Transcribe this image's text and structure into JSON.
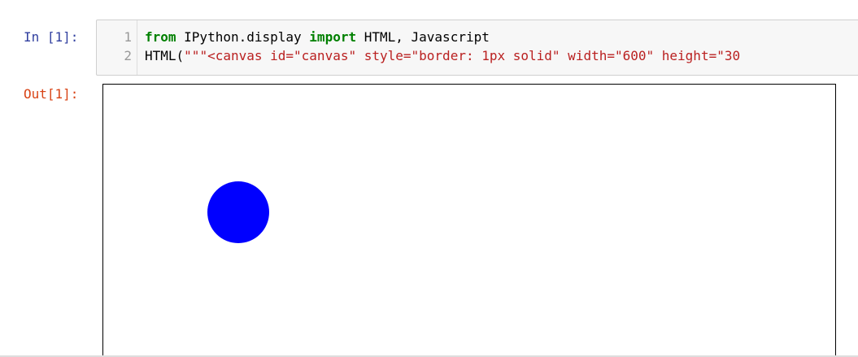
{
  "input_prompt": "In [1]:",
  "output_prompt": "Out[1]:",
  "code": {
    "line_numbers": [
      "1",
      "2"
    ],
    "line1": {
      "kw_from": "from",
      "module": " IPython.display ",
      "kw_import": "import",
      "names": " HTML, Javascript"
    },
    "line2": {
      "call": "HTML(",
      "string": "\"\"\"<canvas id=\"canvas\" style=\"border: 1px solid\" width=\"600\" height=\"30"
    }
  },
  "output": {
    "type": "canvas",
    "ball_color": "#0000ff"
  },
  "colors": {
    "in_prompt": "#303f9f",
    "out_prompt": "#d84315",
    "keyword": "#008000",
    "string": "#ba2121"
  }
}
